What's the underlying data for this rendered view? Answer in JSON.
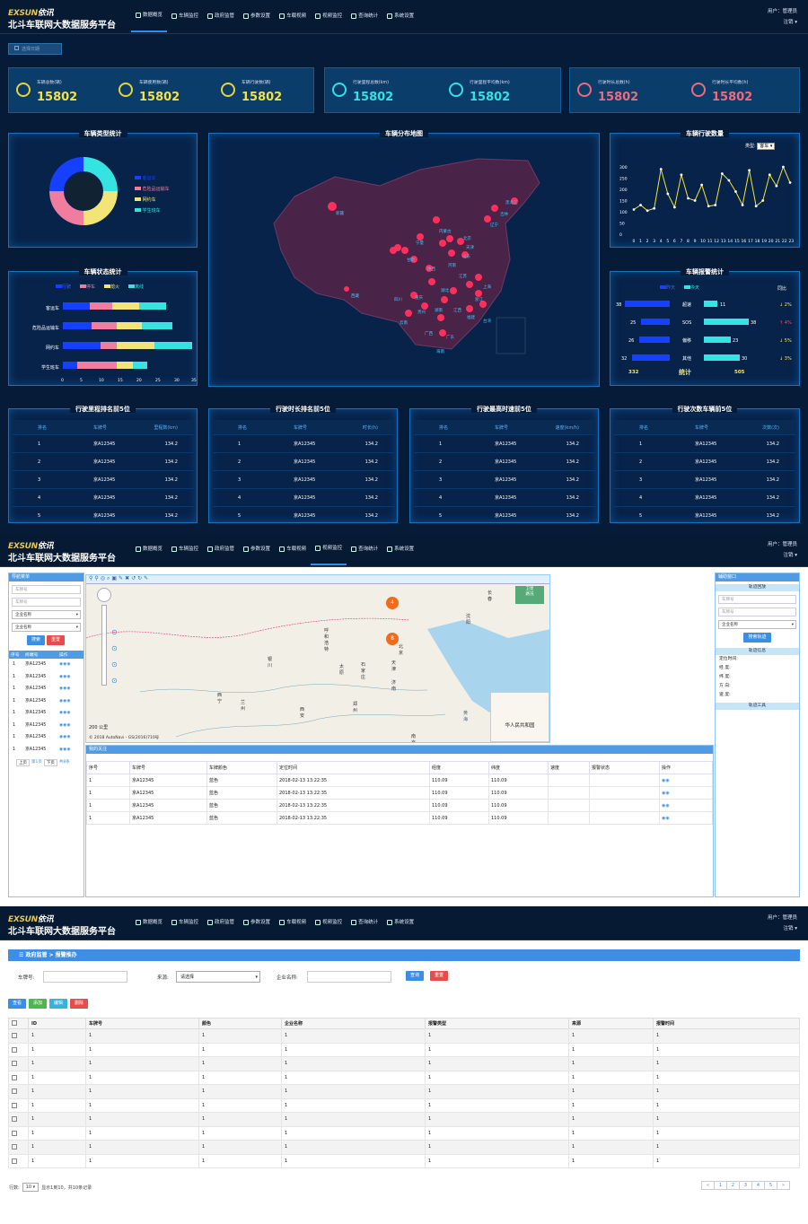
{
  "header": {
    "logo_a": "EXSUN",
    "logo_b": "依讯",
    "title": "北斗车联网大数据服务平台",
    "user_label": "用户：管理员",
    "logout": "注销"
  },
  "nav": [
    {
      "label": "数据概览",
      "icon": "dashboard-icon"
    },
    {
      "label": "车辆监控",
      "icon": "car-icon"
    },
    {
      "label": "政府监管",
      "icon": "government-icon"
    },
    {
      "label": "参数设置",
      "icon": "settings-doc-icon"
    },
    {
      "label": "车载视频",
      "icon": "video-icon"
    },
    {
      "label": "视频监控",
      "icon": "camera-icon"
    },
    {
      "label": "查询统计",
      "icon": "bar-chart-icon"
    },
    {
      "label": "系统设置",
      "icon": "gear-icon"
    }
  ],
  "dashboard": {
    "date_picker": "选择日期",
    "stats": [
      {
        "label": "车辆总数(辆)",
        "value": "15802"
      },
      {
        "label": "车辆使用数(辆)",
        "value": "15802"
      },
      {
        "label": "车辆行驶数(辆)",
        "value": "15802"
      },
      {
        "label": "行驶里程总数(km)",
        "value": "15802"
      },
      {
        "label": "行驶里程平均数(km)",
        "value": "15802"
      },
      {
        "label": "行驶时长总数(h)",
        "value": "15802"
      },
      {
        "label": "行驶时长平均数(h)",
        "value": "15802"
      }
    ],
    "vehicle_type": {
      "title": "车辆类型统计",
      "legend": [
        "客运车",
        "危险品运输车",
        "网约车",
        "学生班车"
      ],
      "colors": [
        "#1540ff",
        "#f07ca0",
        "#f3e478",
        "#36e3e3"
      ],
      "values": [
        25,
        25,
        25,
        25
      ]
    },
    "map": {
      "title": "车辆分布地图",
      "cities": [
        "新疆",
        "宁夏",
        "甘肃",
        "内蒙古",
        "北京",
        "天津",
        "山东",
        "河南",
        "陕西",
        "四川",
        "重庆",
        "湖北",
        "江苏",
        "上海",
        "浙江",
        "福建",
        "广东",
        "广西",
        "云南",
        "贵州",
        "湖南",
        "江西",
        "西藏",
        "吉林",
        "辽宁",
        "黑龙江",
        "台湾",
        "海南"
      ]
    },
    "vehicle_drive": {
      "title": "车辆行驶数量",
      "type_label": "类型:",
      "type_value": "客车",
      "yticks": [
        "300",
        "250",
        "200",
        "150",
        "100",
        "50",
        "0"
      ],
      "xticks": [
        "0",
        "1",
        "2",
        "3",
        "4",
        "5",
        "6",
        "7",
        "8",
        "9",
        "10",
        "11",
        "12",
        "13",
        "14",
        "15",
        "16",
        "17",
        "18",
        "19",
        "20",
        "21",
        "22",
        "23"
      ]
    },
    "vehicle_status": {
      "title": "车辆状态统计",
      "legend": [
        "行驶",
        "停车",
        "熄火",
        "离线"
      ],
      "colors": [
        "#1540ff",
        "#f07ca0",
        "#f3e478",
        "#36e3e3"
      ],
      "categories": [
        "客运车",
        "危险品运输车",
        "网约车",
        "学生班车"
      ],
      "xticks": [
        "0",
        "5",
        "10",
        "15",
        "20",
        "25",
        "30",
        "35"
      ]
    },
    "alarm": {
      "title": "车辆报警统计",
      "legend": [
        "昨天",
        "今天"
      ],
      "compare_label": "同比",
      "rows": [
        {
          "name": "超速",
          "yesterday": "38",
          "today": "11",
          "delta": "2%"
        },
        {
          "name": "SOS",
          "yesterday": "25",
          "today": "38",
          "delta": "4%"
        },
        {
          "name": "偏移",
          "yesterday": "26",
          "today": "23",
          "delta": "5%"
        },
        {
          "name": "其他",
          "yesterday": "32",
          "today": "30",
          "delta": "3%"
        }
      ],
      "total_label": "统计",
      "total_yesterday": "332",
      "total_today": "505"
    },
    "rank_tables": [
      {
        "title": "行驶里程排名前5位",
        "cols": [
          "排名",
          "车牌号",
          "里程数(km)"
        ]
      },
      {
        "title": "行驶时长排名前5位",
        "cols": [
          "排名",
          "车牌号",
          "时长(h)"
        ]
      },
      {
        "title": "行驶最高时速前5位",
        "cols": [
          "排名",
          "车牌号",
          "速度(km/h)"
        ]
      },
      {
        "title": "行驶次数车辆前5位",
        "cols": [
          "排名",
          "车牌号",
          "次数(次)"
        ]
      }
    ],
    "rank_rows": [
      [
        "1",
        "京A12345",
        "134.2"
      ],
      [
        "2",
        "京A12345",
        "134.2"
      ],
      [
        "3",
        "京A12345",
        "134.2"
      ],
      [
        "4",
        "京A12345",
        "134.2"
      ],
      [
        "5",
        "京A12345",
        "134.2"
      ]
    ]
  },
  "monitor": {
    "left_title": "导航菜单",
    "plate_ph1": "车牌号",
    "plate_ph2": "车牌号",
    "company_sel1": "企业名称",
    "company_sel2": "企业名称",
    "search": "搜索",
    "reset": "重置",
    "list_cols": [
      "序号",
      "终端号",
      "操作"
    ],
    "list_rows": [
      [
        "1",
        "京A12345"
      ],
      [
        "1",
        "京A12345"
      ],
      [
        "1",
        "京A12345"
      ],
      [
        "1",
        "京A12345"
      ],
      [
        "1",
        "京A12345"
      ],
      [
        "1",
        "京A12345"
      ],
      [
        "1",
        "京A12345"
      ],
      [
        "1",
        "京A12345"
      ]
    ],
    "pager": [
      "上页",
      "第1页",
      "下页",
      "共8条"
    ],
    "map_labels": [
      "长春",
      "沈阳",
      "呼和浩特",
      "北京",
      "天津",
      "银川",
      "太原",
      "石家庄",
      "济南",
      "西宁",
      "兰州",
      "西安",
      "郑州",
      "南京"
    ],
    "cluster": [
      "4",
      "8"
    ],
    "map_switch": [
      "卫星",
      "路况"
    ],
    "scale": "200 公里",
    "copyright": "© 2018 AutoNavi - GS(2016)710号",
    "inset_label": "华人民共和国",
    "sea": "黄海",
    "follow_title": "我的关注",
    "follow_cols": [
      "序号",
      "车牌号",
      "车牌颜色",
      "定位时间",
      "经度",
      "纬度",
      "速度",
      "报警状态",
      "操作"
    ],
    "follow_rows": [
      [
        "1",
        "京A12345",
        "蓝色",
        "2018-02-13 13:22:35",
        "110.09",
        "110.09"
      ],
      [
        "1",
        "京A12345",
        "蓝色",
        "2018-02-13 13:22:35",
        "110.09",
        "110.09"
      ],
      [
        "1",
        "京A12345",
        "蓝色",
        "2018-02-13 13:22:35",
        "110.09",
        "110.09"
      ],
      [
        "1",
        "京A12345",
        "蓝色",
        "2018-02-13 13:22:35",
        "110.09",
        "110.09"
      ]
    ],
    "right_title": "辅助窗口",
    "track_query": "轨迹回放",
    "r_plate1": "车牌号",
    "r_plate2": "车牌号",
    "r_company": "企业名称",
    "track_btn": "搜索轨迹",
    "track_info": "轨迹信息",
    "info": [
      "定位时间:",
      "经 度:",
      "纬 度:",
      "方 向:",
      "速 度:"
    ],
    "track_tools": "轨迹工具"
  },
  "alarm_page": {
    "breadcrumb": "政府监管 > 报警推办",
    "plate_label": "车牌号:",
    "source_label": "来源:",
    "source_value": "请选择",
    "company_label": "企业名称:",
    "query": "查询",
    "reset": "重置",
    "actions": [
      "查看",
      "添加",
      "编辑",
      "删除"
    ],
    "cols": [
      "ID",
      "车牌号",
      "颜色",
      "企业名称",
      "报警类型",
      "来源",
      "报警时间"
    ],
    "rows": [
      [
        "1",
        "1",
        "1",
        "1",
        "1",
        "1",
        "1"
      ],
      [
        "1",
        "1",
        "1",
        "1",
        "1",
        "1",
        "1"
      ],
      [
        "1",
        "1",
        "1",
        "1",
        "1",
        "1",
        "1"
      ],
      [
        "1",
        "1",
        "1",
        "1",
        "1",
        "1",
        "1"
      ],
      [
        "1",
        "1",
        "1",
        "1",
        "1",
        "1",
        "1"
      ],
      [
        "1",
        "1",
        "1",
        "1",
        "1",
        "1",
        "1"
      ],
      [
        "1",
        "1",
        "1",
        "1",
        "1",
        "1",
        "1"
      ],
      [
        "1",
        "1",
        "1",
        "1",
        "1",
        "1",
        "1"
      ],
      [
        "1",
        "1",
        "1",
        "1",
        "1",
        "1",
        "1"
      ],
      [
        "1",
        "1",
        "1",
        "1",
        "1",
        "1",
        "1"
      ]
    ],
    "rows_label": "行数:",
    "page_size": "10",
    "summary": "显示1到10，共10条记录",
    "pages": [
      "«",
      "1",
      "2",
      "3",
      "4",
      "5",
      "»"
    ]
  }
}
